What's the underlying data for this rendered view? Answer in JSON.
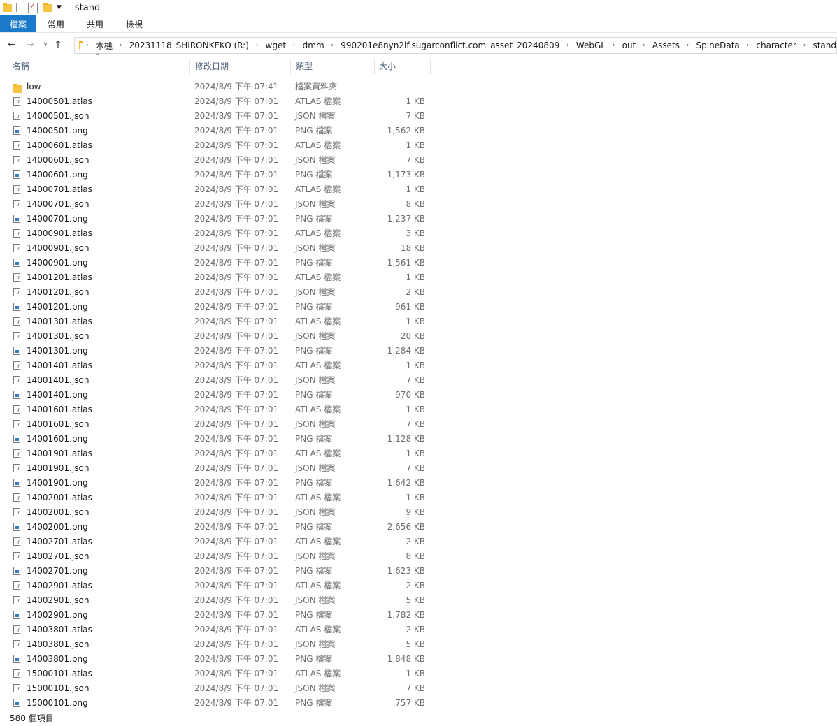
{
  "window": {
    "title": "stand"
  },
  "ribbon": {
    "tabs": [
      "檔案",
      "常用",
      "共用",
      "檢視"
    ]
  },
  "address": {
    "crumbs": [
      "本機",
      "20231118_SHIRONKEKO (R:)",
      "wget",
      "dmm",
      "990201e8nyn2lf.sugarconflict.com_asset_20240809",
      "WebGL",
      "out",
      "Assets",
      "SpineData",
      "character",
      "stand"
    ]
  },
  "columns": {
    "name": "名稱",
    "date": "修改日期",
    "type": "類型",
    "size": "大小"
  },
  "files": [
    {
      "name": "low",
      "date": "2024/8/9 下午 07:41",
      "type": "檔案資料夾",
      "size": "",
      "icon": "folder"
    },
    {
      "name": "14000501.atlas",
      "date": "2024/8/9 下午 07:01",
      "type": "ATLAS 檔案",
      "size": "1 KB",
      "icon": "file"
    },
    {
      "name": "14000501.json",
      "date": "2024/8/9 下午 07:01",
      "type": "JSON 檔案",
      "size": "7 KB",
      "icon": "file"
    },
    {
      "name": "14000501.png",
      "date": "2024/8/9 下午 07:01",
      "type": "PNG 檔案",
      "size": "1,562 KB",
      "icon": "png"
    },
    {
      "name": "14000601.atlas",
      "date": "2024/8/9 下午 07:01",
      "type": "ATLAS 檔案",
      "size": "1 KB",
      "icon": "file"
    },
    {
      "name": "14000601.json",
      "date": "2024/8/9 下午 07:01",
      "type": "JSON 檔案",
      "size": "7 KB",
      "icon": "file"
    },
    {
      "name": "14000601.png",
      "date": "2024/8/9 下午 07:01",
      "type": "PNG 檔案",
      "size": "1,173 KB",
      "icon": "png"
    },
    {
      "name": "14000701.atlas",
      "date": "2024/8/9 下午 07:01",
      "type": "ATLAS 檔案",
      "size": "1 KB",
      "icon": "file"
    },
    {
      "name": "14000701.json",
      "date": "2024/8/9 下午 07:01",
      "type": "JSON 檔案",
      "size": "8 KB",
      "icon": "file"
    },
    {
      "name": "14000701.png",
      "date": "2024/8/9 下午 07:01",
      "type": "PNG 檔案",
      "size": "1,237 KB",
      "icon": "png"
    },
    {
      "name": "14000901.atlas",
      "date": "2024/8/9 下午 07:01",
      "type": "ATLAS 檔案",
      "size": "3 KB",
      "icon": "file"
    },
    {
      "name": "14000901.json",
      "date": "2024/8/9 下午 07:01",
      "type": "JSON 檔案",
      "size": "18 KB",
      "icon": "file"
    },
    {
      "name": "14000901.png",
      "date": "2024/8/9 下午 07:01",
      "type": "PNG 檔案",
      "size": "1,561 KB",
      "icon": "png"
    },
    {
      "name": "14001201.atlas",
      "date": "2024/8/9 下午 07:01",
      "type": "ATLAS 檔案",
      "size": "1 KB",
      "icon": "file"
    },
    {
      "name": "14001201.json",
      "date": "2024/8/9 下午 07:01",
      "type": "JSON 檔案",
      "size": "2 KB",
      "icon": "file"
    },
    {
      "name": "14001201.png",
      "date": "2024/8/9 下午 07:01",
      "type": "PNG 檔案",
      "size": "961 KB",
      "icon": "png"
    },
    {
      "name": "14001301.atlas",
      "date": "2024/8/9 下午 07:01",
      "type": "ATLAS 檔案",
      "size": "1 KB",
      "icon": "file"
    },
    {
      "name": "14001301.json",
      "date": "2024/8/9 下午 07:01",
      "type": "JSON 檔案",
      "size": "20 KB",
      "icon": "file"
    },
    {
      "name": "14001301.png",
      "date": "2024/8/9 下午 07:01",
      "type": "PNG 檔案",
      "size": "1,284 KB",
      "icon": "png"
    },
    {
      "name": "14001401.atlas",
      "date": "2024/8/9 下午 07:01",
      "type": "ATLAS 檔案",
      "size": "1 KB",
      "icon": "file"
    },
    {
      "name": "14001401.json",
      "date": "2024/8/9 下午 07:01",
      "type": "JSON 檔案",
      "size": "7 KB",
      "icon": "file"
    },
    {
      "name": "14001401.png",
      "date": "2024/8/9 下午 07:01",
      "type": "PNG 檔案",
      "size": "970 KB",
      "icon": "png"
    },
    {
      "name": "14001601.atlas",
      "date": "2024/8/9 下午 07:01",
      "type": "ATLAS 檔案",
      "size": "1 KB",
      "icon": "file"
    },
    {
      "name": "14001601.json",
      "date": "2024/8/9 下午 07:01",
      "type": "JSON 檔案",
      "size": "7 KB",
      "icon": "file"
    },
    {
      "name": "14001601.png",
      "date": "2024/8/9 下午 07:01",
      "type": "PNG 檔案",
      "size": "1,128 KB",
      "icon": "png"
    },
    {
      "name": "14001901.atlas",
      "date": "2024/8/9 下午 07:01",
      "type": "ATLAS 檔案",
      "size": "1 KB",
      "icon": "file"
    },
    {
      "name": "14001901.json",
      "date": "2024/8/9 下午 07:01",
      "type": "JSON 檔案",
      "size": "7 KB",
      "icon": "file"
    },
    {
      "name": "14001901.png",
      "date": "2024/8/9 下午 07:01",
      "type": "PNG 檔案",
      "size": "1,642 KB",
      "icon": "png"
    },
    {
      "name": "14002001.atlas",
      "date": "2024/8/9 下午 07:01",
      "type": "ATLAS 檔案",
      "size": "1 KB",
      "icon": "file"
    },
    {
      "name": "14002001.json",
      "date": "2024/8/9 下午 07:01",
      "type": "JSON 檔案",
      "size": "9 KB",
      "icon": "file"
    },
    {
      "name": "14002001.png",
      "date": "2024/8/9 下午 07:01",
      "type": "PNG 檔案",
      "size": "2,656 KB",
      "icon": "png"
    },
    {
      "name": "14002701.atlas",
      "date": "2024/8/9 下午 07:01",
      "type": "ATLAS 檔案",
      "size": "2 KB",
      "icon": "file"
    },
    {
      "name": "14002701.json",
      "date": "2024/8/9 下午 07:01",
      "type": "JSON 檔案",
      "size": "8 KB",
      "icon": "file"
    },
    {
      "name": "14002701.png",
      "date": "2024/8/9 下午 07:01",
      "type": "PNG 檔案",
      "size": "1,623 KB",
      "icon": "png"
    },
    {
      "name": "14002901.atlas",
      "date": "2024/8/9 下午 07:01",
      "type": "ATLAS 檔案",
      "size": "2 KB",
      "icon": "file"
    },
    {
      "name": "14002901.json",
      "date": "2024/8/9 下午 07:01",
      "type": "JSON 檔案",
      "size": "5 KB",
      "icon": "file"
    },
    {
      "name": "14002901.png",
      "date": "2024/8/9 下午 07:01",
      "type": "PNG 檔案",
      "size": "1,782 KB",
      "icon": "png"
    },
    {
      "name": "14003801.atlas",
      "date": "2024/8/9 下午 07:01",
      "type": "ATLAS 檔案",
      "size": "2 KB",
      "icon": "file"
    },
    {
      "name": "14003801.json",
      "date": "2024/8/9 下午 07:01",
      "type": "JSON 檔案",
      "size": "5 KB",
      "icon": "file"
    },
    {
      "name": "14003801.png",
      "date": "2024/8/9 下午 07:01",
      "type": "PNG 檔案",
      "size": "1,848 KB",
      "icon": "png"
    },
    {
      "name": "15000101.atlas",
      "date": "2024/8/9 下午 07:01",
      "type": "ATLAS 檔案",
      "size": "1 KB",
      "icon": "file"
    },
    {
      "name": "15000101.json",
      "date": "2024/8/9 下午 07:01",
      "type": "JSON 檔案",
      "size": "7 KB",
      "icon": "file"
    },
    {
      "name": "15000101.png",
      "date": "2024/8/9 下午 07:01",
      "type": "PNG 檔案",
      "size": "757 KB",
      "icon": "png"
    }
  ],
  "status": {
    "count": "580 個項目"
  }
}
